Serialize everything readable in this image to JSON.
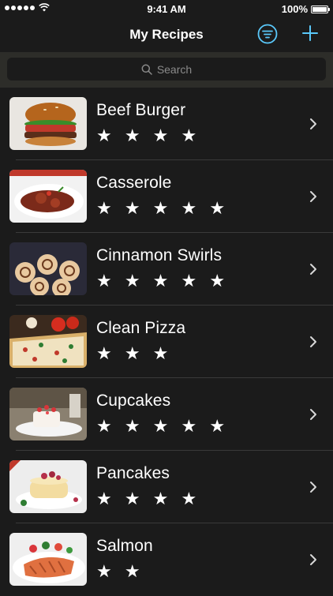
{
  "status_bar": {
    "time": "9:41 AM",
    "battery": "100%"
  },
  "nav": {
    "title": "My Recipes",
    "icons": [
      "filter-icon",
      "plus-icon"
    ],
    "accent": "#5ac8fa"
  },
  "search": {
    "placeholder": "Search"
  },
  "recipes": [
    {
      "name": "Beef Burger",
      "stars": "★ ★ ★ ★",
      "rating": 4
    },
    {
      "name": "Casserole",
      "stars": "★ ★ ★ ★ ★",
      "rating": 5
    },
    {
      "name": "Cinnamon Swirls",
      "stars": "★ ★ ★ ★ ★",
      "rating": 5
    },
    {
      "name": "Clean Pizza",
      "stars": "★ ★ ★",
      "rating": 3
    },
    {
      "name": "Cupcakes",
      "stars": "★ ★ ★ ★ ★",
      "rating": 5
    },
    {
      "name": "Pancakes",
      "stars": "★ ★ ★ ★",
      "rating": 4
    },
    {
      "name": "Salmon",
      "stars": "★ ★",
      "rating": 2
    }
  ]
}
